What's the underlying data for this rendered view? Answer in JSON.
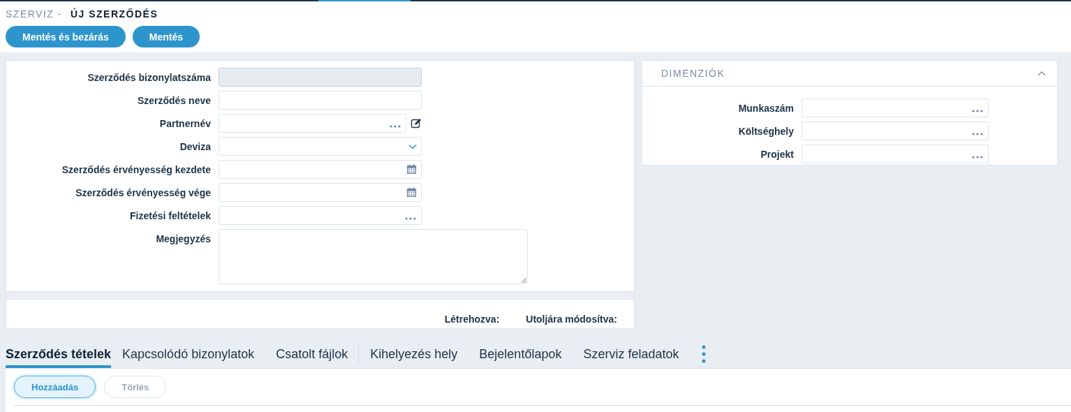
{
  "breadcrumb": {
    "section": "SZERVIZ -",
    "title": "ÚJ SZERZŐDÉS"
  },
  "actions": [
    "Mentés és bezárás",
    "Mentés"
  ],
  "form": {
    "fields": [
      {
        "label": "Szerződés bizonylatszáma",
        "kind": "text",
        "disabled": true
      },
      {
        "label": "Szerződés neve",
        "kind": "text",
        "disabled": false
      },
      {
        "label": "Partnernév",
        "kind": "lookup_edit",
        "disabled": false
      },
      {
        "label": "Deviza",
        "kind": "select",
        "disabled": false
      },
      {
        "label": "Szerződés érvényesség kezdete",
        "kind": "date",
        "disabled": false
      },
      {
        "label": "Szerződés érvényesség vége",
        "kind": "date",
        "disabled": false
      },
      {
        "label": "Fizetési feltételek",
        "kind": "lookup",
        "disabled": false
      },
      {
        "label": "Megjegyzés",
        "kind": "textarea",
        "disabled": false
      }
    ]
  },
  "dimensions": {
    "title": "DIMENZIÓK",
    "expanded": true,
    "fields": [
      {
        "label": "Munkaszám",
        "kind": "lookup"
      },
      {
        "label": "Költséghely",
        "kind": "lookup"
      },
      {
        "label": "Projekt",
        "kind": "lookup"
      }
    ]
  },
  "audit": [
    {
      "label": "Létrehozva:"
    },
    {
      "label": "Utoljára módosítva:"
    }
  ],
  "tabs": [
    {
      "label": "Szerződés tételek",
      "selected": true,
      "divider_before": false
    },
    {
      "label": "Kapcsolódó bizonylatok",
      "selected": false,
      "divider_before": false
    },
    {
      "label": "Csatolt fájlok",
      "selected": false,
      "divider_before": false
    },
    {
      "label": "Kihelyezés hely",
      "selected": false,
      "divider_before": true
    },
    {
      "label": "Bejelentőlapok",
      "selected": false,
      "divider_before": false
    },
    {
      "label": "Szerviz feladatok",
      "selected": false,
      "divider_before": false
    }
  ],
  "tab_actions": [
    {
      "label": "Hozzáadás",
      "disabled": false
    },
    {
      "label": "Törlés",
      "disabled": true
    }
  ]
}
